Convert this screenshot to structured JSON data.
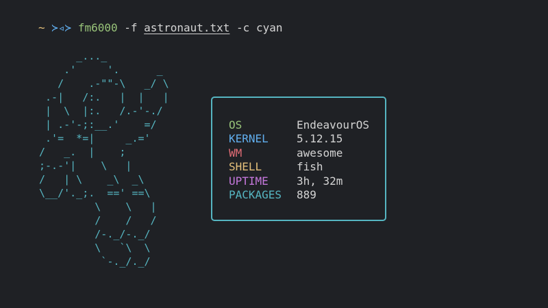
{
  "prompt": {
    "tilde": "~",
    "arrows": "≻◃≻",
    "command": "fm6000",
    "flag1": "-f",
    "file": "astronaut.txt",
    "flag2": "-c",
    "color_arg": "cyan"
  },
  "ascii_art": "      _..._\n    .'     '.      _\n   /    .-\"\"-\\   _/ \\\n .-|   /:.   |  |   |\n |  \\  |:.   /.-'-./\n | .-'-;:__.'    =/\n .'=  *=|     _.='\n/   _.  |    ;\n;-.-'|    \\   |\n/   | \\    _\\  _\\\n\\__/'._;.  ==' ==\\\n         \\    \\   |\n         /    /   /\n         /-._/-._/\n         \\   `\\  \\\n          `-._/._/",
  "ascii_color": "#56b6c2",
  "info": [
    {
      "key": "OS",
      "value": "EndeavourOS",
      "color": "#98c379"
    },
    {
      "key": "KERNEL",
      "value": "5.12.15",
      "color": "#61afef"
    },
    {
      "key": "WM",
      "value": "awesome",
      "color": "#e06c75"
    },
    {
      "key": "SHELL",
      "value": "fish",
      "color": "#e5c07b"
    },
    {
      "key": "UPTIME",
      "value": "3h, 32m",
      "color": "#c678dd"
    },
    {
      "key": "PACKAGES",
      "value": "889",
      "color": "#56b6c2"
    }
  ],
  "colors": {
    "background": "#1f2125",
    "box_border": "#56b6c2",
    "text": "#d4d4d4"
  }
}
